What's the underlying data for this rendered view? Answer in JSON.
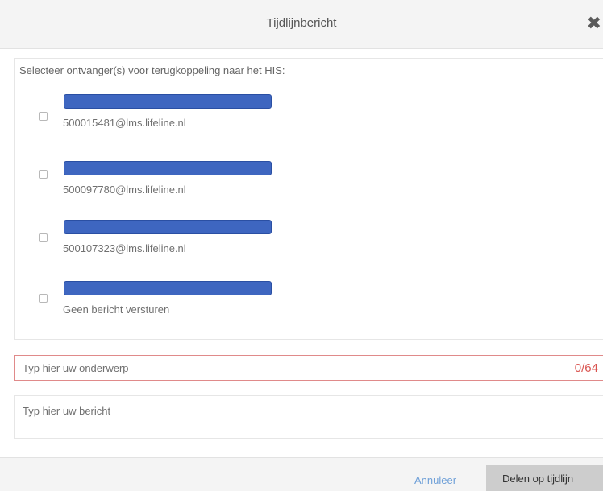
{
  "header": {
    "title": "Tijdlijnbericht",
    "close_glyph": "✖"
  },
  "recipients": {
    "label": "Selecteer ontvanger(s) voor terugkoppeling naar het HIS:",
    "items": [
      {
        "address": "500015481@lms.lifeline.nl",
        "checked": false
      },
      {
        "address": "500097780@lms.lifeline.nl",
        "checked": false
      },
      {
        "address": "500107323@lms.lifeline.nl",
        "checked": false
      },
      {
        "address": "Geen bericht versturen",
        "checked": false
      }
    ],
    "redaction_color": "#3e66c0"
  },
  "subject": {
    "placeholder": "Typ hier uw onderwerp",
    "value": "",
    "counter": "0/64"
  },
  "message": {
    "placeholder": "Typ hier uw bericht",
    "value": ""
  },
  "footer": {
    "cancel_label": "Annuleer",
    "share_label": "Delen op tijdlijn"
  },
  "colors": {
    "link": "#6fa0d8",
    "error": "#d9534f",
    "button": "#cdcdcd"
  }
}
